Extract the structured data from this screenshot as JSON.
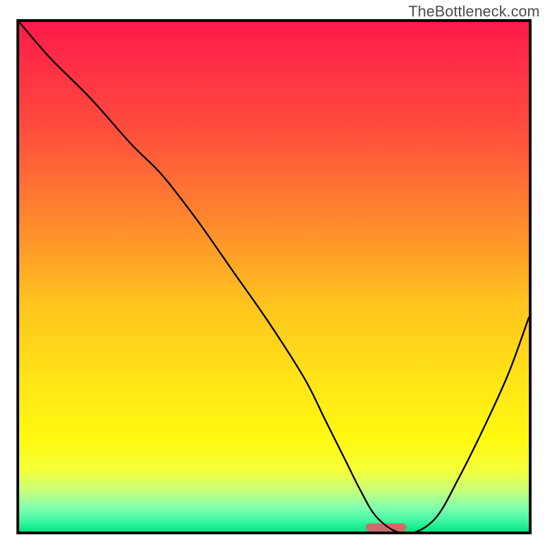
{
  "watermark": "TheBottleneck.com",
  "chart_data": {
    "type": "line",
    "title": "",
    "xlabel": "",
    "ylabel": "",
    "xlim": [
      0,
      100
    ],
    "ylim": [
      0,
      100
    ],
    "grid": false,
    "legend": false,
    "annotations": [],
    "background_gradient": {
      "type": "vertical",
      "stops": [
        {
          "pos": 0.0,
          "color": "#ff1a4b"
        },
        {
          "pos": 0.2,
          "color": "#ff4a3e"
        },
        {
          "pos": 0.4,
          "color": "#ff8b2c"
        },
        {
          "pos": 0.55,
          "color": "#ffc31e"
        },
        {
          "pos": 0.72,
          "color": "#ffe816"
        },
        {
          "pos": 0.82,
          "color": "#fff90f"
        },
        {
          "pos": 0.88,
          "color": "#f5ff3a"
        },
        {
          "pos": 0.92,
          "color": "#c6ff7a"
        },
        {
          "pos": 0.955,
          "color": "#7dffb0"
        },
        {
          "pos": 0.98,
          "color": "#3cf6a0"
        },
        {
          "pos": 1.0,
          "color": "#00e681"
        }
      ]
    },
    "series": [
      {
        "name": "bottleneck-curve",
        "color": "#000000",
        "width": 2.4,
        "x": [
          0,
          6,
          14,
          22,
          28,
          35,
          42,
          49,
          56,
          60,
          64,
          67,
          70,
          74,
          78,
          82,
          86,
          91,
          96,
          100
        ],
        "y": [
          100,
          93,
          85,
          76,
          70,
          61,
          51,
          41,
          30,
          22,
          14,
          8,
          3,
          0,
          0,
          3,
          10,
          20,
          31,
          42
        ]
      }
    ],
    "marker": {
      "name": "optimal-range",
      "shape": "capsule",
      "color": "#d06a6a",
      "x_center": 72,
      "x_half_width": 4,
      "y": 0,
      "height_pct": 1.6
    }
  }
}
